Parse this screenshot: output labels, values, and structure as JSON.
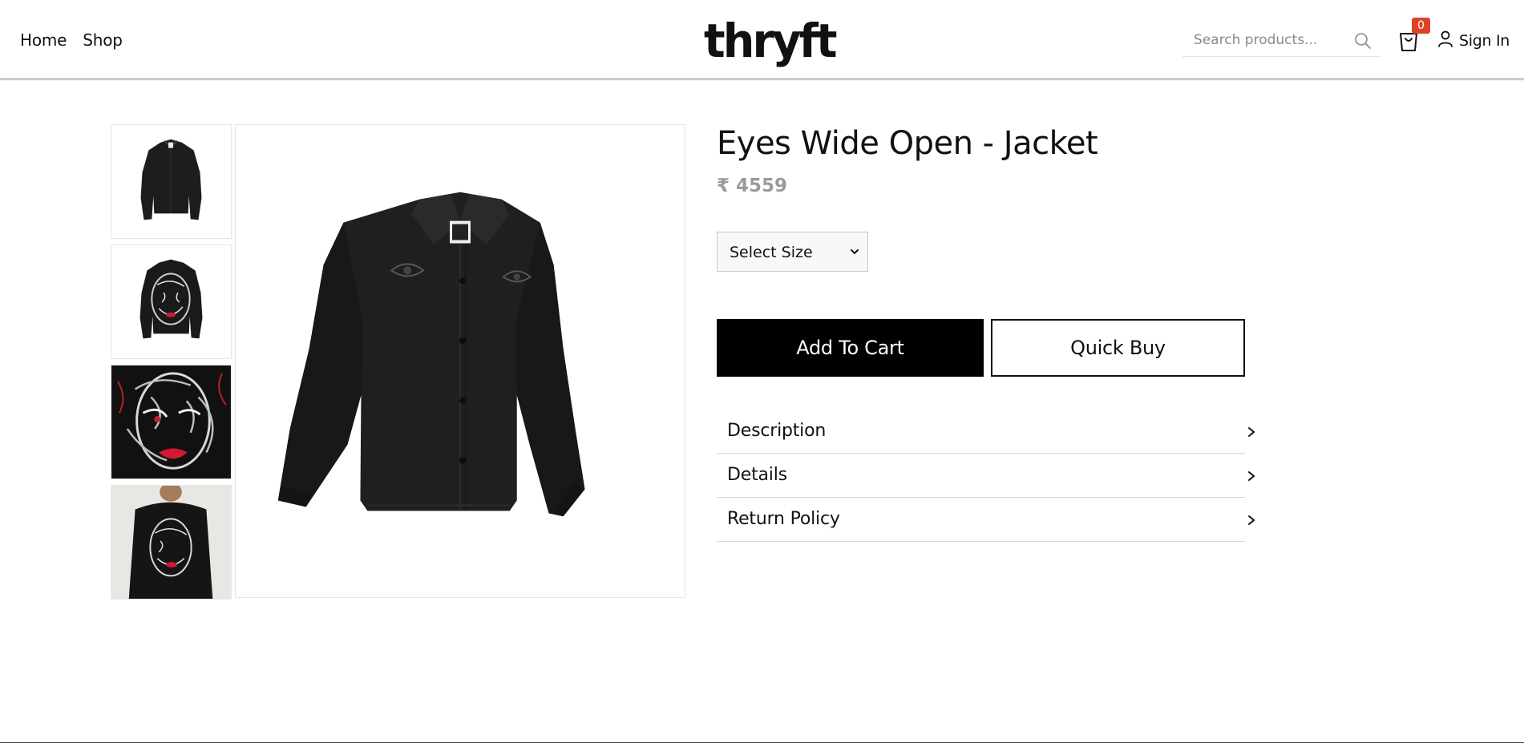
{
  "header": {
    "nav": [
      "Home",
      "Shop"
    ],
    "logo": "thryft",
    "search_placeholder": "Search products...",
    "cart_count": "0",
    "signin_label": "Sign In",
    "icons": [
      "search-icon",
      "cart-icon",
      "user-icon"
    ],
    "badge_color": "#e0412b"
  },
  "product": {
    "title": "Eyes Wide Open - Jacket",
    "price": "₹ 4559",
    "size_select": "Select Size",
    "add_to_cart": "Add To Cart",
    "quick_buy": "Quick Buy",
    "sections": [
      "Description",
      "Details",
      "Return Policy"
    ]
  },
  "gallery": {
    "thumbnails": [
      "jacket-front",
      "jacket-back-painted",
      "painted-face-closeup",
      "model-back"
    ],
    "main_image": "jacket-front"
  },
  "colors": {
    "primary": "#000000",
    "price": "#9a9a9a",
    "divider": "#d6d6d6"
  }
}
